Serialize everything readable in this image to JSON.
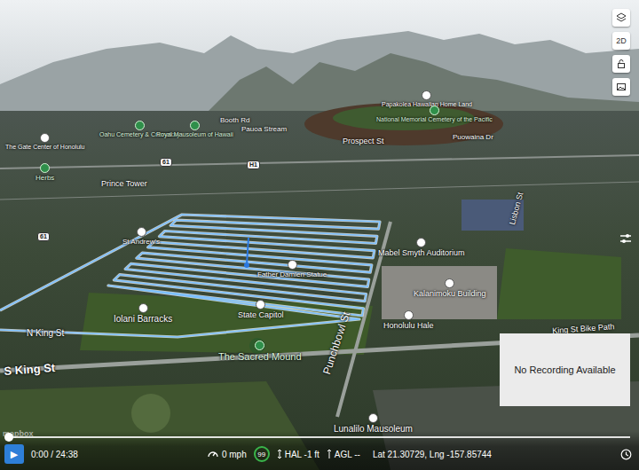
{
  "map": {
    "labels": [
      {
        "text": "The Gate Center of Honolulu",
        "kind": "place"
      },
      {
        "text": "Oahu Cemetery & Crematory",
        "kind": "park"
      },
      {
        "text": "Royal Mausoleum of Hawaii",
        "kind": "park"
      },
      {
        "text": "Booth Rd",
        "kind": "road"
      },
      {
        "text": "Pauoa Stream",
        "kind": "road"
      },
      {
        "text": "Papakolea Hawaiian Home Land",
        "kind": "place"
      },
      {
        "text": "National Memorial Cemetery of the Pacific",
        "kind": "park"
      },
      {
        "text": "Puowaina Dr",
        "kind": "road"
      },
      {
        "text": "Prospect St",
        "kind": "road"
      },
      {
        "text": "Herbs",
        "kind": "park"
      },
      {
        "text": "Prince Tower",
        "kind": "road"
      },
      {
        "text": "St Andrew's",
        "kind": "place"
      },
      {
        "text": "Father Damien Statue",
        "kind": "place"
      },
      {
        "text": "Mabel Smyth Auditorium",
        "kind": "place"
      },
      {
        "text": "Kalanimoku Building",
        "kind": "place"
      },
      {
        "text": "Iolani Barracks",
        "kind": "place"
      },
      {
        "text": "State Capitol",
        "kind": "place"
      },
      {
        "text": "N King St",
        "kind": "road"
      },
      {
        "text": "Lisbon St",
        "kind": "street"
      },
      {
        "text": "Honolulu Hale",
        "kind": "place"
      },
      {
        "text": "King St Bike Path",
        "kind": "road"
      },
      {
        "text": "The Sacred Mound",
        "kind": "park"
      },
      {
        "text": "S King St",
        "kind": "road"
      },
      {
        "text": "Punchbowl St",
        "kind": "street"
      },
      {
        "text": "Lunalilo Mausoleum",
        "kind": "place"
      },
      {
        "text": "61",
        "kind": "shield"
      },
      {
        "text": "61",
        "kind": "shield"
      },
      {
        "text": "H1",
        "kind": "shield"
      }
    ]
  },
  "controls": [
    {
      "label": "2D"
    }
  ],
  "recording": {
    "text": "No Recording Available"
  },
  "attribution": "mapbox",
  "playback": {
    "play": "▶",
    "time": "0:00 / 24:38",
    "progress": {
      "level": 0
    }
  },
  "telemetry": {
    "speed": "0 mph",
    "signal": "99",
    "hal": "HAL -1 ft",
    "agl": "AGL --",
    "coords": "Lat 21.30729, Lng -157.85744"
  }
}
